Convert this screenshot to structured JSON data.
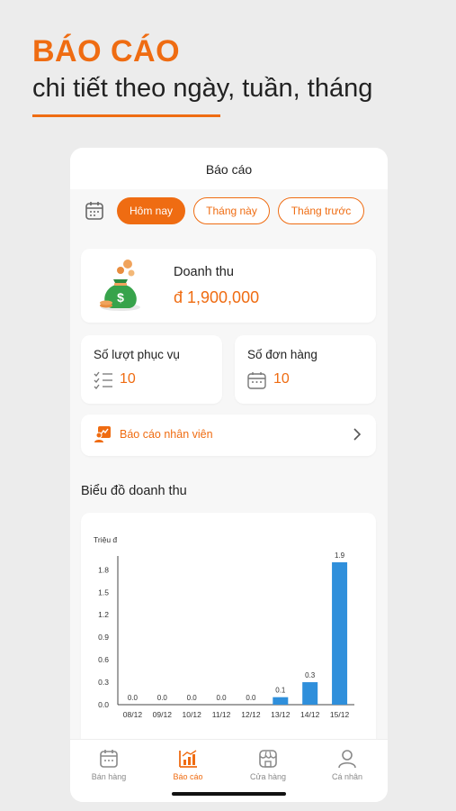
{
  "promo": {
    "title": "BÁO CÁO",
    "subtitle": "chi tiết theo ngày, tuần, tháng"
  },
  "app": {
    "header_title": "Báo cáo",
    "filters": [
      "Hôm nay",
      "Tháng này",
      "Tháng trước"
    ],
    "active_filter": "Hôm nay",
    "revenue": {
      "label": "Doanh thu",
      "value": "đ 1,900,000"
    },
    "stats": [
      {
        "label": "Số lượt phục vụ",
        "value": "10",
        "icon": "checklist-icon"
      },
      {
        "label": "Số đơn hàng",
        "value": "10",
        "icon": "calendar-icon"
      }
    ],
    "staff_report": {
      "label": "Báo cáo nhân viên"
    },
    "chart_section_title": "Biểu đồ doanh thu",
    "tabs": [
      {
        "label": "Bán hàng",
        "icon": "calendar-icon"
      },
      {
        "label": "Báo cáo",
        "icon": "chart-icon"
      },
      {
        "label": "Cửa hàng",
        "icon": "store-icon"
      },
      {
        "label": "Cá nhân",
        "icon": "person-icon"
      }
    ],
    "active_tab": "Báo cáo",
    "accent_color": "#ef6c12",
    "bar_color": "#2f8fdb"
  },
  "chart_data": {
    "type": "bar",
    "ylabel": "Triệu đ",
    "categories": [
      "08/12",
      "09/12",
      "10/12",
      "11/12",
      "12/12",
      "13/12",
      "14/12",
      "15/12"
    ],
    "values": [
      0.0,
      0.0,
      0.0,
      0.0,
      0.0,
      0.1,
      0.3,
      1.9
    ],
    "data_labels": [
      "0.0",
      "0.0",
      "0.0",
      "0.0",
      "0.0",
      "0.1",
      "0.3",
      "1.9"
    ],
    "y_ticks": [
      "0.0",
      "0.3",
      "0.6",
      "0.9",
      "1.2",
      "1.5",
      "1.8"
    ],
    "ylim": [
      0,
      1.9
    ],
    "grid": false
  }
}
